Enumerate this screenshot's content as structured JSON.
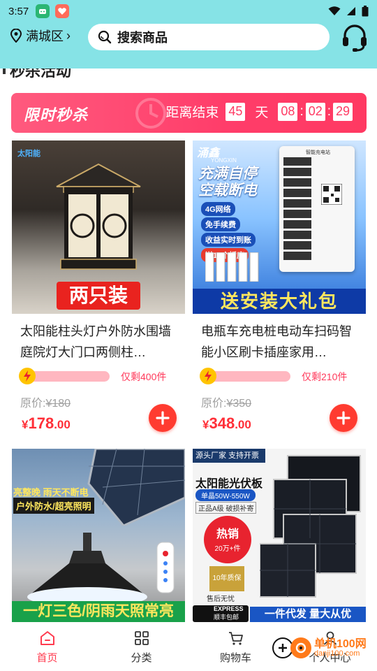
{
  "status_bar": {
    "time": "3:57"
  },
  "header": {
    "location": "满城区",
    "search_placeholder": "搜索商品"
  },
  "section": {
    "title": "秒杀活动"
  },
  "flash_sale": {
    "title": "限时秒杀",
    "end_label": "距离结束",
    "days": "45",
    "day_unit": "天",
    "hours": "08",
    "minutes": "02",
    "seconds": "29"
  },
  "products": [
    {
      "name": "太阳能柱头灯户外防水围墙庭院灯大门口两侧柱…",
      "remaining": "仅剩400件",
      "orig_label": "原价:",
      "orig_price": "¥180",
      "price_symbol": "¥",
      "price_int": "178",
      "price_dec": ".00",
      "image_text": "两只装",
      "image_brand": "太阳能"
    },
    {
      "name": "电瓶车充电桩电动车扫码智能小区刷卡插座家用…",
      "remaining": "仅剩210件",
      "orig_label": "原价:",
      "orig_price": "¥350",
      "price_symbol": "¥",
      "price_int": "348",
      "price_dec": ".00",
      "image_text": "送安装大礼包",
      "image_brand": "涌鑫",
      "image_brand_en": "YONGXIN",
      "image_slogan": "充满自停 空载断电",
      "image_tags": [
        "4G网络",
        "免手续费",
        "收益实时到账",
        "送10个插座"
      ],
      "image_device": "智能充电站"
    },
    {
      "name": "",
      "image_top": "亮整晚 雨天不断电",
      "image_mid": "户外防水/超亮照明",
      "image_bottom": "一灯三色/阴雨天照常亮"
    },
    {
      "name": "",
      "image_top": "源头厂家 支持开票",
      "image_title": "太阳能光伏板",
      "image_spec": "单晶50W-550W",
      "image_sub": "正品A级 破损补寄",
      "image_hot": "热销",
      "image_hot2": "20万+件",
      "image_warranty": "10年质保",
      "image_after": "售后无忧",
      "image_express": "EXPRESS",
      "image_express2": "顺丰包邮",
      "image_bottom": "一件代发 量大从优"
    }
  ],
  "nav": [
    {
      "label": "首页",
      "icon": "home-icon"
    },
    {
      "label": "分类",
      "icon": "grid-icon"
    },
    {
      "label": "购物车",
      "icon": "cart-icon"
    },
    {
      "label": "个人中心",
      "icon": "user-icon"
    }
  ],
  "watermark": {
    "line1": "单机100网",
    "line2": "danji100.com"
  },
  "colors": {
    "accent": "#ff3b4f",
    "header_bg": "#86e3e6",
    "price": "#ff2f38"
  }
}
